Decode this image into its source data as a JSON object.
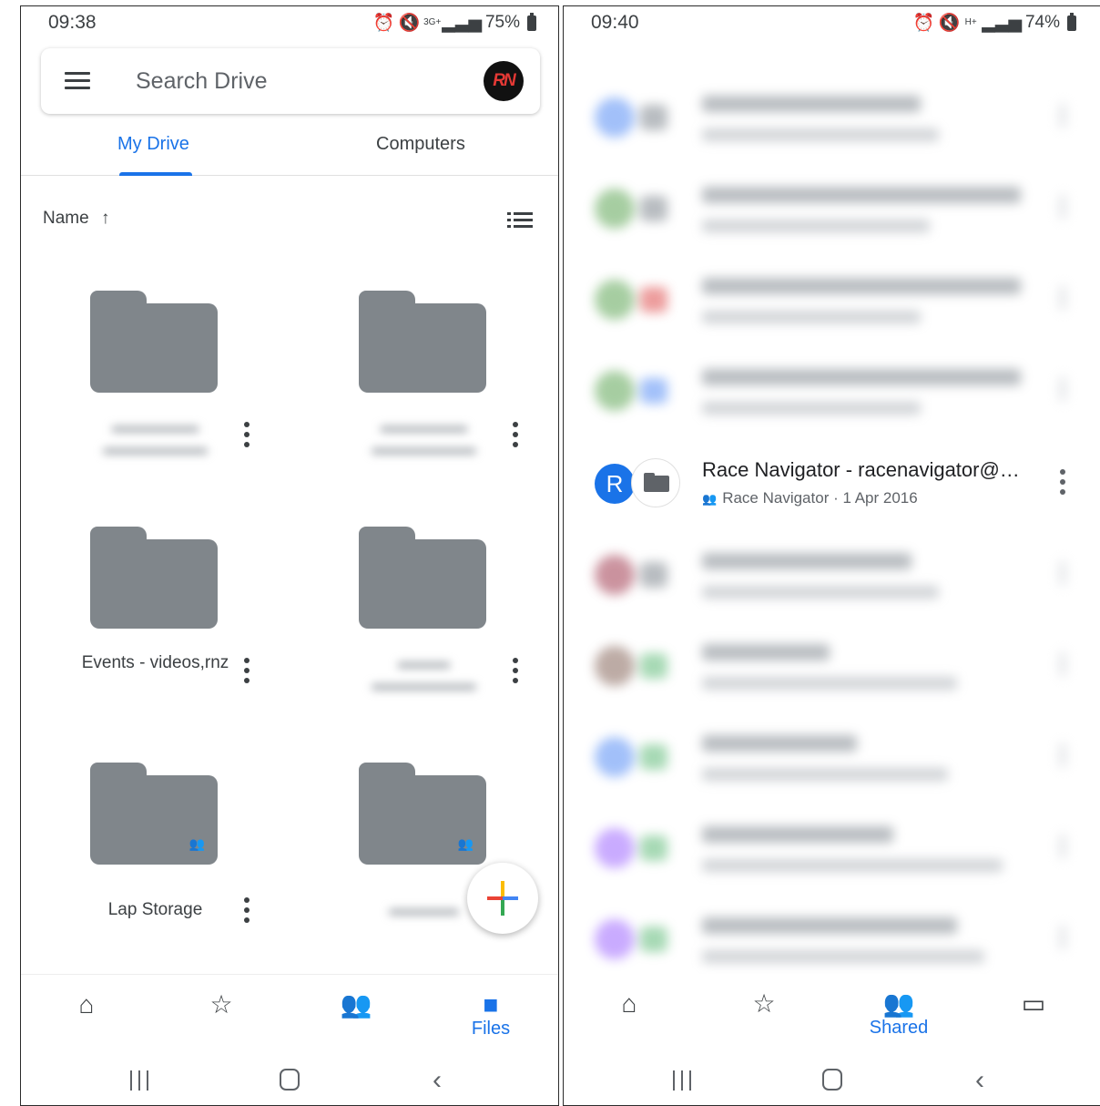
{
  "left": {
    "status": {
      "time": "09:38",
      "battery": "75%",
      "net": "3G+"
    },
    "search": {
      "placeholder": "Search Drive",
      "avatar_text": "RN"
    },
    "tabs": [
      {
        "label": "My Drive",
        "active": true
      },
      {
        "label": "Computers",
        "active": false
      }
    ],
    "sort": {
      "label": "Name",
      "arrow": "↑"
    },
    "folders": [
      {
        "name": "",
        "shared": false,
        "blurred": true
      },
      {
        "name": "",
        "shared": false,
        "blurred": true
      },
      {
        "name": "Events - videos,rnz",
        "shared": false,
        "blurred": false
      },
      {
        "name": "",
        "shared": false,
        "blurred": true
      },
      {
        "name": "Lap Storage",
        "shared": true,
        "blurred": false
      },
      {
        "name": "",
        "shared": true,
        "blurred": true
      }
    ],
    "bottom_nav": [
      {
        "label": "",
        "icon": "home-icon",
        "active": false
      },
      {
        "label": "",
        "icon": "star-icon",
        "active": false
      },
      {
        "label": "",
        "icon": "shared-icon",
        "active": false
      },
      {
        "label": "Files",
        "icon": "folder-icon",
        "active": true
      }
    ]
  },
  "right": {
    "status": {
      "time": "09:40",
      "battery": "74%",
      "net": "H+"
    },
    "shared_item": {
      "avatar_letter": "R",
      "title": "Race Navigator - racenavigator@…",
      "owner": "Race Navigator",
      "date": "1 Apr 2016"
    },
    "bottom_nav": [
      {
        "label": "",
        "icon": "home-icon",
        "active": false
      },
      {
        "label": "",
        "icon": "star-icon",
        "active": false
      },
      {
        "label": "Shared",
        "icon": "shared-icon",
        "active": true
      },
      {
        "label": "",
        "icon": "folder-icon",
        "active": false
      }
    ]
  },
  "colors": {
    "accent": "#1a73e8",
    "folder": "#80868b"
  }
}
